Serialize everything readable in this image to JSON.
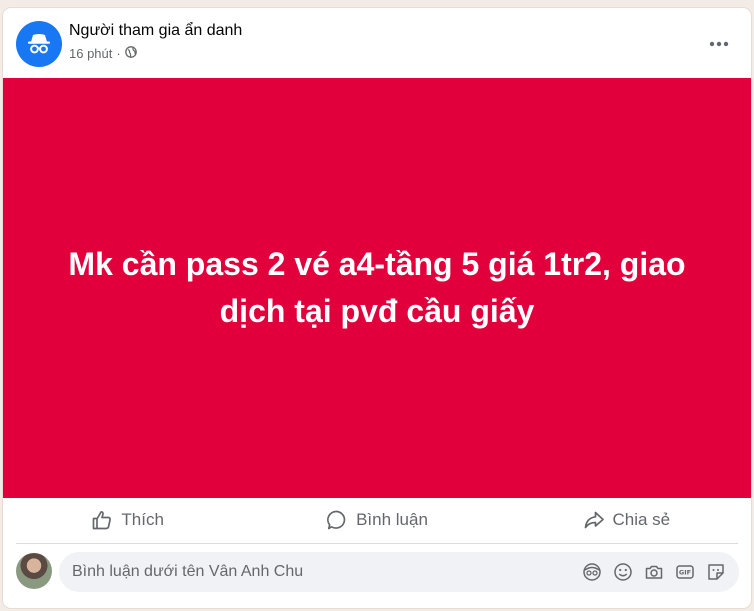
{
  "post": {
    "author": "Người tham gia ẩn danh",
    "time": "16 phút",
    "separator": "·",
    "privacy_icon": "globe-icon",
    "text": "Mk cần pass 2 vé a4-tầng 5 giá 1tr2, giao dịch tại pvđ cầu giấy",
    "background_color": "#e1003c"
  },
  "actions": {
    "like_label": "Thích",
    "comment_label": "Bình luận",
    "share_label": "Chia sẻ"
  },
  "comment": {
    "placeholder": "Bình luận dưới tên Vân Anh Chu",
    "icons": [
      "avatar-sticker-icon",
      "emoji-icon",
      "camera-icon",
      "gif-icon",
      "sticker-icon"
    ]
  },
  "colors": {
    "accent": "#1877f2",
    "muted_text": "#65676b"
  }
}
